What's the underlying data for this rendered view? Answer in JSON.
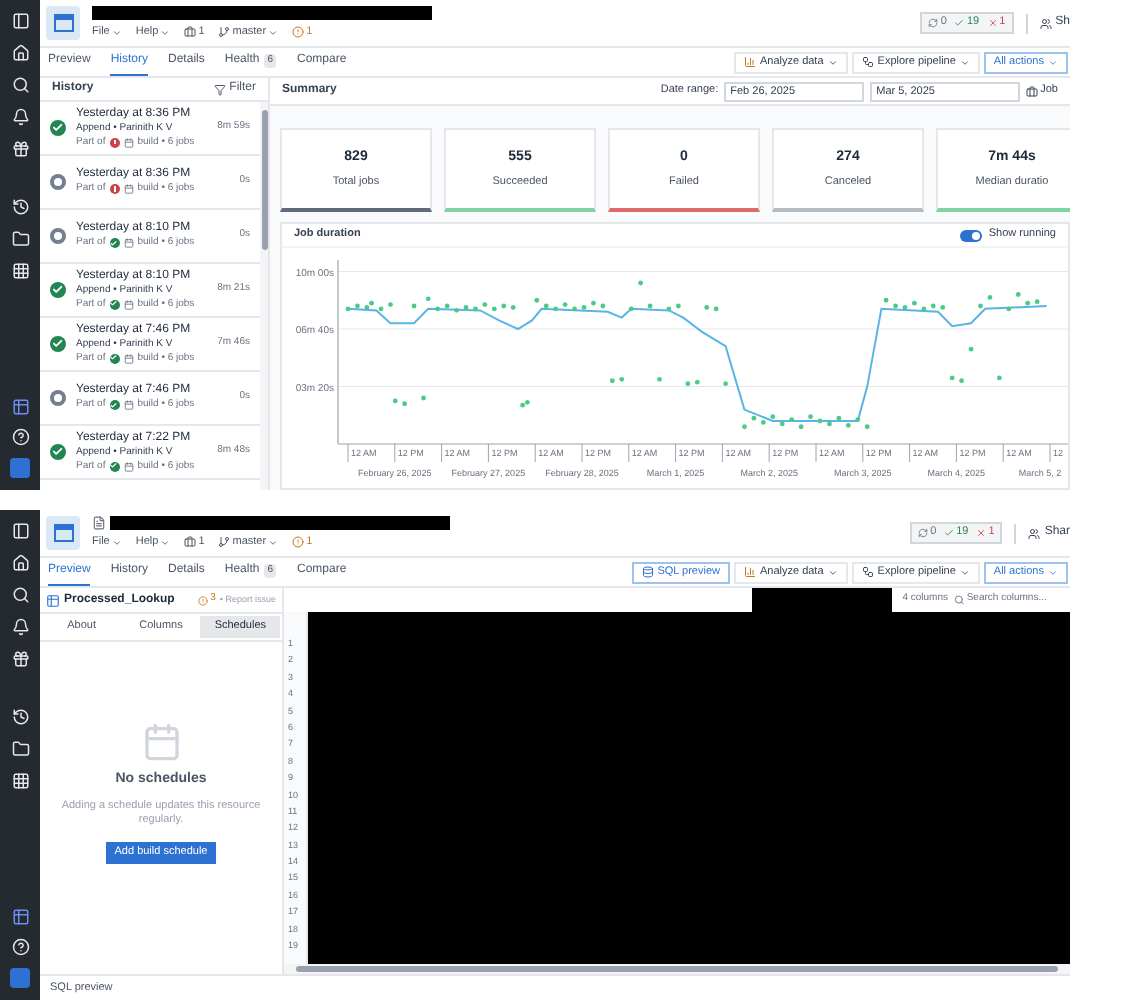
{
  "history_view": {
    "header": {
      "file_menu": "File",
      "help_menu": "Help",
      "repo_count": "1",
      "branch": "master",
      "warning_count": "1",
      "status_badges": [
        {
          "kind": "pending",
          "count": "0"
        },
        {
          "kind": "success",
          "count": "19"
        },
        {
          "kind": "error",
          "count": "1"
        }
      ],
      "share": "Sh"
    },
    "tabs": [
      {
        "label": "Preview",
        "selected": false
      },
      {
        "label": "History",
        "selected": true
      },
      {
        "label": "Details",
        "selected": false
      },
      {
        "label": "Health",
        "count": "6",
        "selected": false
      },
      {
        "label": "Compare",
        "selected": false
      }
    ],
    "toolbar": [
      {
        "kind": "analyze",
        "label": "Analyze data"
      },
      {
        "kind": "explore",
        "label": "Explore pipeline"
      },
      {
        "kind": "actions",
        "label": "All actions"
      }
    ],
    "history": {
      "title": "History",
      "filter": "Filter",
      "items": [
        {
          "kind": "succeeded",
          "time": "Yesterday at 8:36 PM",
          "detail": "Append • Parinith K V",
          "part_of": "Part of",
          "parent_failed": true,
          "build": "build • 6 jobs",
          "duration": "8m 59s"
        },
        {
          "kind": "canceled",
          "time": "Yesterday at 8:36 PM",
          "part_of": "Part of",
          "parent_failed": true,
          "build": "build • 6 jobs",
          "duration": "0s"
        },
        {
          "kind": "canceled",
          "time": "Yesterday at 8:10 PM",
          "part_of": "Part of",
          "parent_failed": false,
          "build": "build • 6 jobs",
          "duration": "0s"
        },
        {
          "kind": "succeeded",
          "time": "Yesterday at 8:10 PM",
          "detail": "Append • Parinith K V",
          "part_of": "Part of",
          "parent_failed": false,
          "build": "build • 6 jobs",
          "duration": "8m 21s"
        },
        {
          "kind": "succeeded",
          "time": "Yesterday at 7:46 PM",
          "detail": "Append • Parinith K V",
          "part_of": "Part of",
          "parent_failed": false,
          "build": "build • 6 jobs",
          "duration": "7m 46s"
        },
        {
          "kind": "canceled",
          "time": "Yesterday at 7:46 PM",
          "part_of": "Part of",
          "parent_failed": false,
          "build": "build • 6 jobs",
          "duration": "0s"
        },
        {
          "kind": "succeeded",
          "time": "Yesterday at 7:22 PM",
          "detail": "Append • Parinith K V",
          "part_of": "Part of",
          "parent_failed": false,
          "build": "build • 6 jobs",
          "duration": "8m 48s"
        }
      ]
    },
    "summary": {
      "title": "Summary",
      "date_range_label": "Date range:",
      "start_date": "Feb 26, 2025",
      "end_date": "Mar 5, 2025",
      "jobs_button": "Job"
    },
    "stats": [
      {
        "value": "829",
        "label": "Total jobs",
        "color": "#5f6b7a"
      },
      {
        "value": "555",
        "label": "Succeeded",
        "color": "#7fd3a0"
      },
      {
        "value": "0",
        "label": "Failed",
        "color": "#e0696b"
      },
      {
        "value": "274",
        "label": "Canceled",
        "color": "#b5bcc4"
      },
      {
        "value": "7m 44s",
        "label": "Median duratio",
        "color": "#7fd3a0"
      }
    ],
    "job_duration": {
      "title": "Job duration",
      "show_running": {
        "label": "Show running",
        "on": true
      },
      "y_axis_labels": [
        "10m 00s",
        "06m 40s",
        "03m 20s"
      ],
      "x_axis_labels": [
        "12 AM",
        "12 PM",
        "12 AM",
        "12 PM",
        "12 AM",
        "12 PM",
        "12 AM",
        "12 PM",
        "12 AM",
        "12 PM",
        "12 AM",
        "12 PM",
        "12 AM",
        "12 PM",
        "12 AM",
        "12"
      ],
      "date_labels": [
        "February 26, 2025",
        "February 27, 2025",
        "February 28, 2025",
        "March 1, 2025",
        "March 2, 2025",
        "March 3, 2025",
        "March 4, 2025",
        "March 5, 2"
      ]
    }
  },
  "preview_view": {
    "header": {
      "file_menu": "File",
      "help_menu": "Help",
      "repo_count": "1",
      "branch": "master",
      "warning_count": "1",
      "status_badges": [
        {
          "kind": "pending",
          "count": "0"
        },
        {
          "kind": "success",
          "count": "19"
        },
        {
          "kind": "error",
          "count": "1"
        }
      ],
      "share": "Shar"
    },
    "tabs": [
      {
        "label": "Preview",
        "selected": true
      },
      {
        "label": "History",
        "selected": false
      },
      {
        "label": "Details",
        "selected": false
      },
      {
        "label": "Health",
        "count": "6",
        "selected": false
      },
      {
        "label": "Compare",
        "selected": false
      }
    ],
    "toolbar": [
      {
        "kind": "sql",
        "label": "SQL preview"
      },
      {
        "kind": "analyze",
        "label": "Analyze data"
      },
      {
        "kind": "explore",
        "label": "Explore pipeline"
      },
      {
        "kind": "actions",
        "label": "All actions"
      }
    ],
    "dataset": {
      "name": "Processed_Lookup",
      "issue_count": "3",
      "report_issue": "• Report issue"
    },
    "segments": [
      {
        "label": "About",
        "selected": false
      },
      {
        "label": "Columns",
        "selected": false
      },
      {
        "label": "Schedules",
        "selected": true
      }
    ],
    "empty_state": {
      "title": "No schedules",
      "message": "Adding a schedule updates this resource regularly.",
      "button": "Add build schedule"
    },
    "table": {
      "column_count": "4 columns",
      "search": {
        "placeholder": "Search columns..."
      },
      "row_numbers": [
        "1",
        "2",
        "3",
        "4",
        "5",
        "6",
        "7",
        "8",
        "9",
        "10",
        "11",
        "12",
        "13",
        "14",
        "15",
        "16",
        "17",
        "18",
        "19"
      ]
    },
    "footer": "SQL preview"
  }
}
